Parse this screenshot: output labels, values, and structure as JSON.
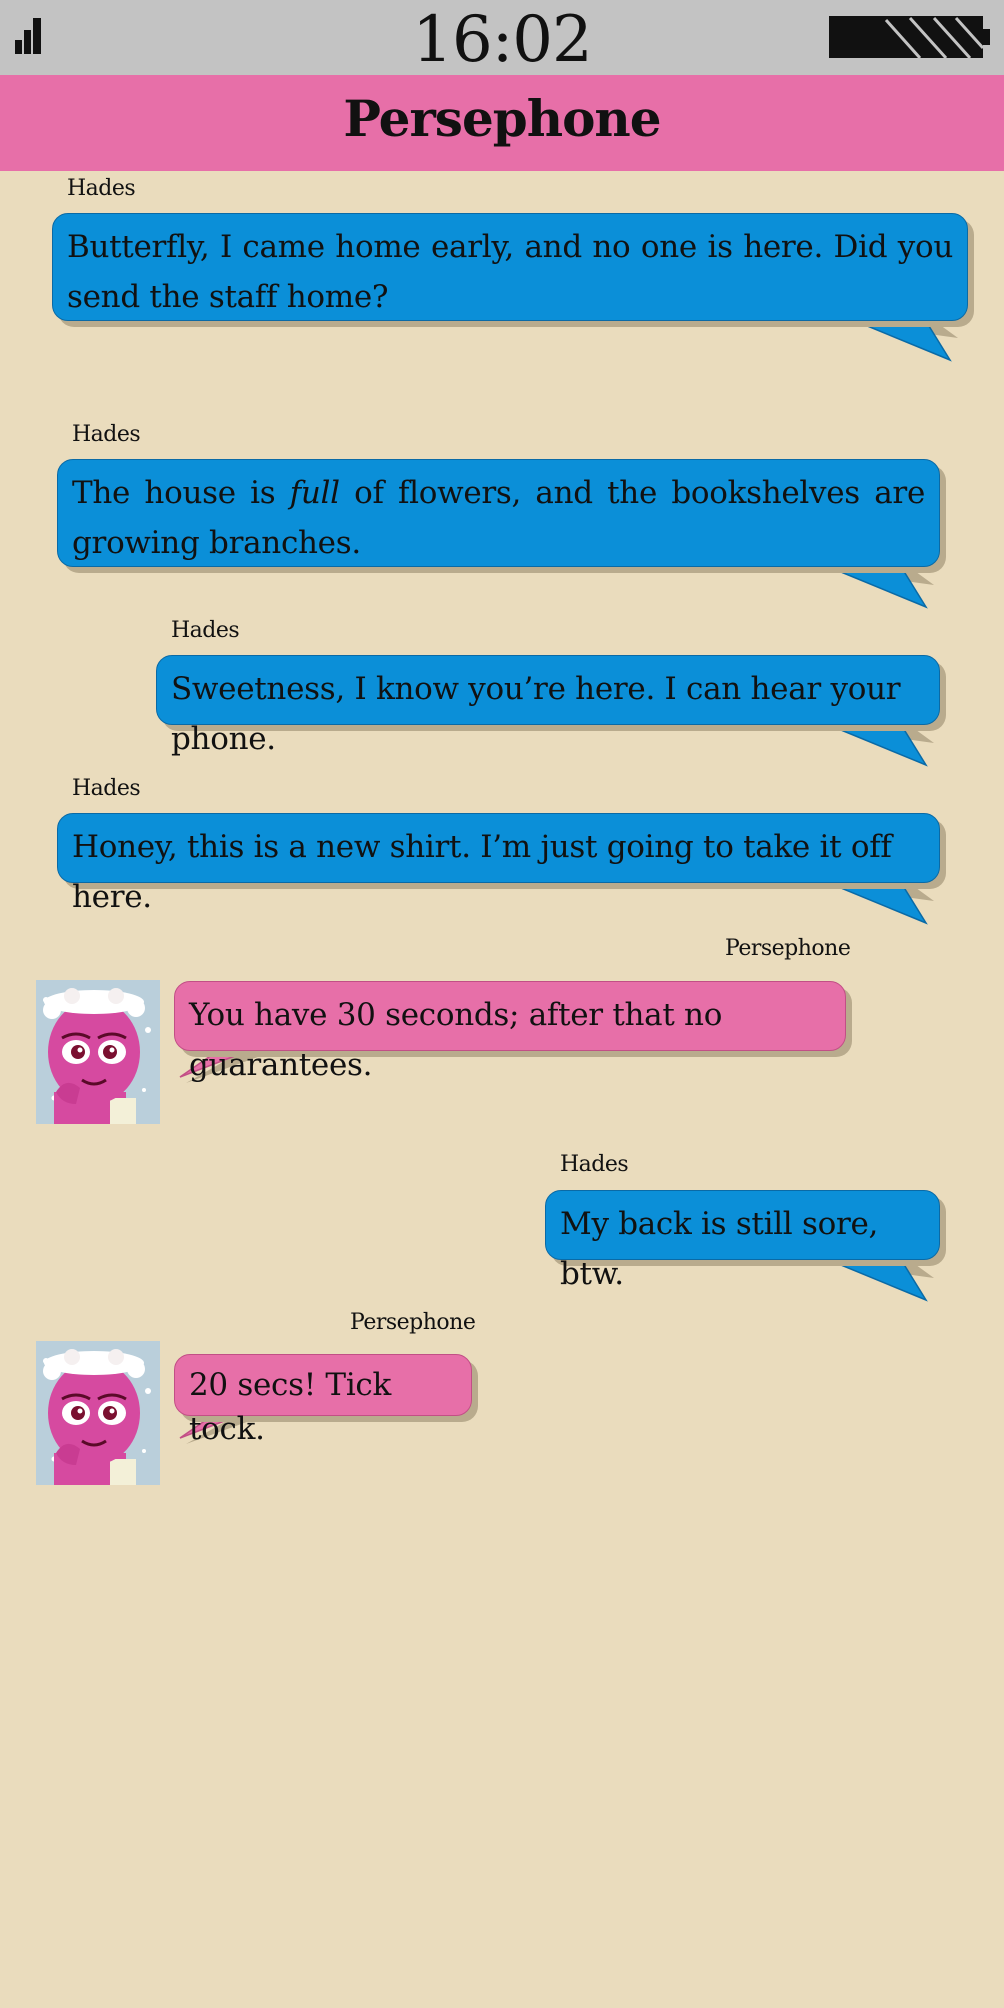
{
  "status_bar": {
    "time": "16:02",
    "signal_icon": "signal-strength-icon",
    "battery_icon": "battery-icon"
  },
  "header": {
    "title": "Persephone"
  },
  "colors": {
    "header": "#e76fa8",
    "status_bar": "#c3c3c3",
    "background": "#eadcbd",
    "hades_bubble": "#0b8fd8",
    "persephone_bubble": "#e76fa8"
  },
  "messages": [
    {
      "sender": "Hades",
      "text": "Butterfly, I came home early, and no one is here. Did you send the staff home?"
    },
    {
      "sender": "Hades",
      "text_before": "The house is ",
      "text_emphasis": "full",
      "text_after": " of flowers, and the bookshelves are growing branches."
    },
    {
      "sender": "Hades",
      "text": "Sweetness, I know you’re here. I can hear your phone."
    },
    {
      "sender": "Hades",
      "text": "Honey, this is a new shirt. I’m just going to take it off here."
    },
    {
      "sender": "Persephone",
      "text": "You have 30 seconds; after that no guarantees.",
      "avatar": "persephone-avatar"
    },
    {
      "sender": "Hades",
      "text": "My back is still sore, btw."
    },
    {
      "sender": "Persephone",
      "text": "20 secs! Tick tock.",
      "avatar": "persephone-avatar"
    }
  ]
}
